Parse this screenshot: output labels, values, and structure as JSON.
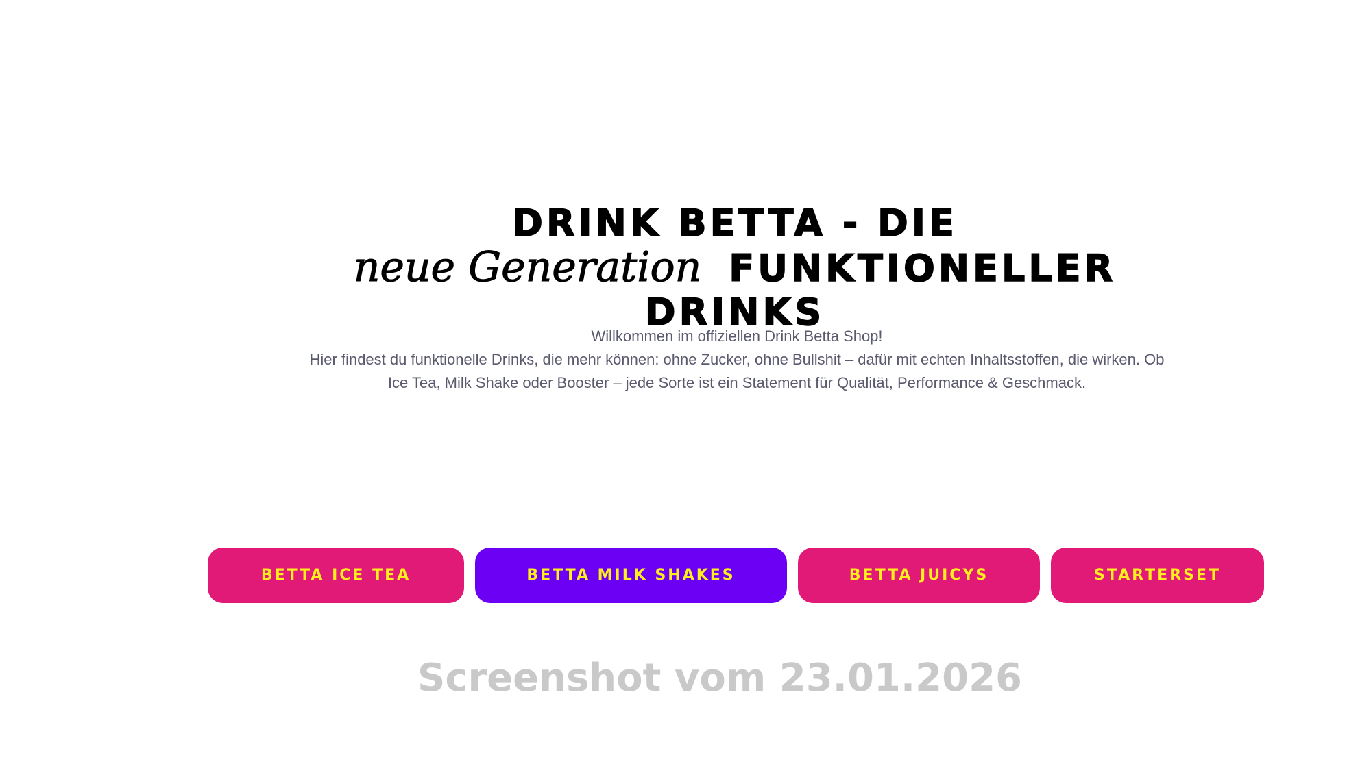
{
  "hero": {
    "title_line1": "DRINK BETTA - DIE",
    "title_script": "neue Generation",
    "title_line2_rest": "FUNKTIONELLER",
    "title_line3": "DRINKS"
  },
  "intro": {
    "line1": "Willkommen im offiziellen Drink Betta Shop!",
    "paragraph": "Hier findest du funktionelle Drinks, die mehr können: ohne Zucker, ohne Bullshit – dafür mit echten Inhaltsstoffen, die wirken. Ob Ice Tea, Milk Shake oder Booster – jede Sorte ist ein Statement für Qualität, Performance & Geschmack."
  },
  "categories": [
    {
      "label": "BETTA ICE TEA",
      "color": "#e11a78"
    },
    {
      "label": "BETTA MILK SHAKES",
      "color": "#6b00f4"
    },
    {
      "label": "BETTA JUICYS",
      "color": "#e11a78"
    },
    {
      "label": "STARTERSET",
      "color": "#e11a78"
    }
  ],
  "button_text_color": "#ffef1c",
  "watermark": "Screenshot vom 23.01.2026"
}
